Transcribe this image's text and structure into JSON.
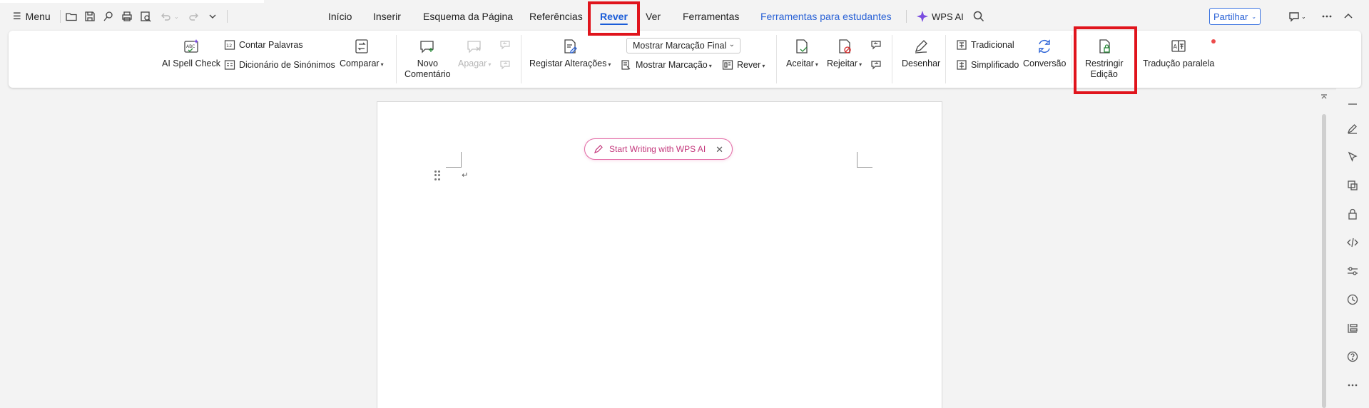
{
  "titlebar": {
    "menu_label": "Menu",
    "tabs": [
      "Início",
      "Inserir",
      "Esquema da Página",
      "Referências",
      "Rever",
      "Ver",
      "Ferramentas",
      "Ferramentas para estudantes"
    ],
    "active_tab": "Rever",
    "wps_ai_label": "WPS AI",
    "share_label": "Partilhar"
  },
  "ribbon": {
    "ai_spell_check": "AI Spell Check",
    "contar_palavras": "Contar Palavras",
    "dicionario": "Dicionário de Sinónimos",
    "comparar": "Comparar",
    "novo_comentario_1": "Novo",
    "novo_comentario_2": "Comentário",
    "apagar": "Apagar",
    "registar_alteracoes": "Registar Alterações",
    "mostrar_marcacao_final": "Mostrar Marcação Final",
    "mostrar_marcacao": "Mostrar Marcação",
    "rever": "Rever",
    "aceitar": "Aceitar",
    "rejeitar": "Rejeitar",
    "desenhar": "Desenhar",
    "tradicional": "Tradicional",
    "simplificado": "Simplificado",
    "conversao": "Conversão",
    "restringir_1": "Restringir",
    "restringir_2": "Edição",
    "traducao_paralela": "Tradução paralela"
  },
  "document": {
    "ai_prompt": "Start Writing with WPS AI",
    "paragraph_mark": "↵"
  },
  "colors": {
    "accent_blue": "#1a5cd8",
    "highlight_red": "#e0141c",
    "ai_pink": "#c4387c"
  }
}
